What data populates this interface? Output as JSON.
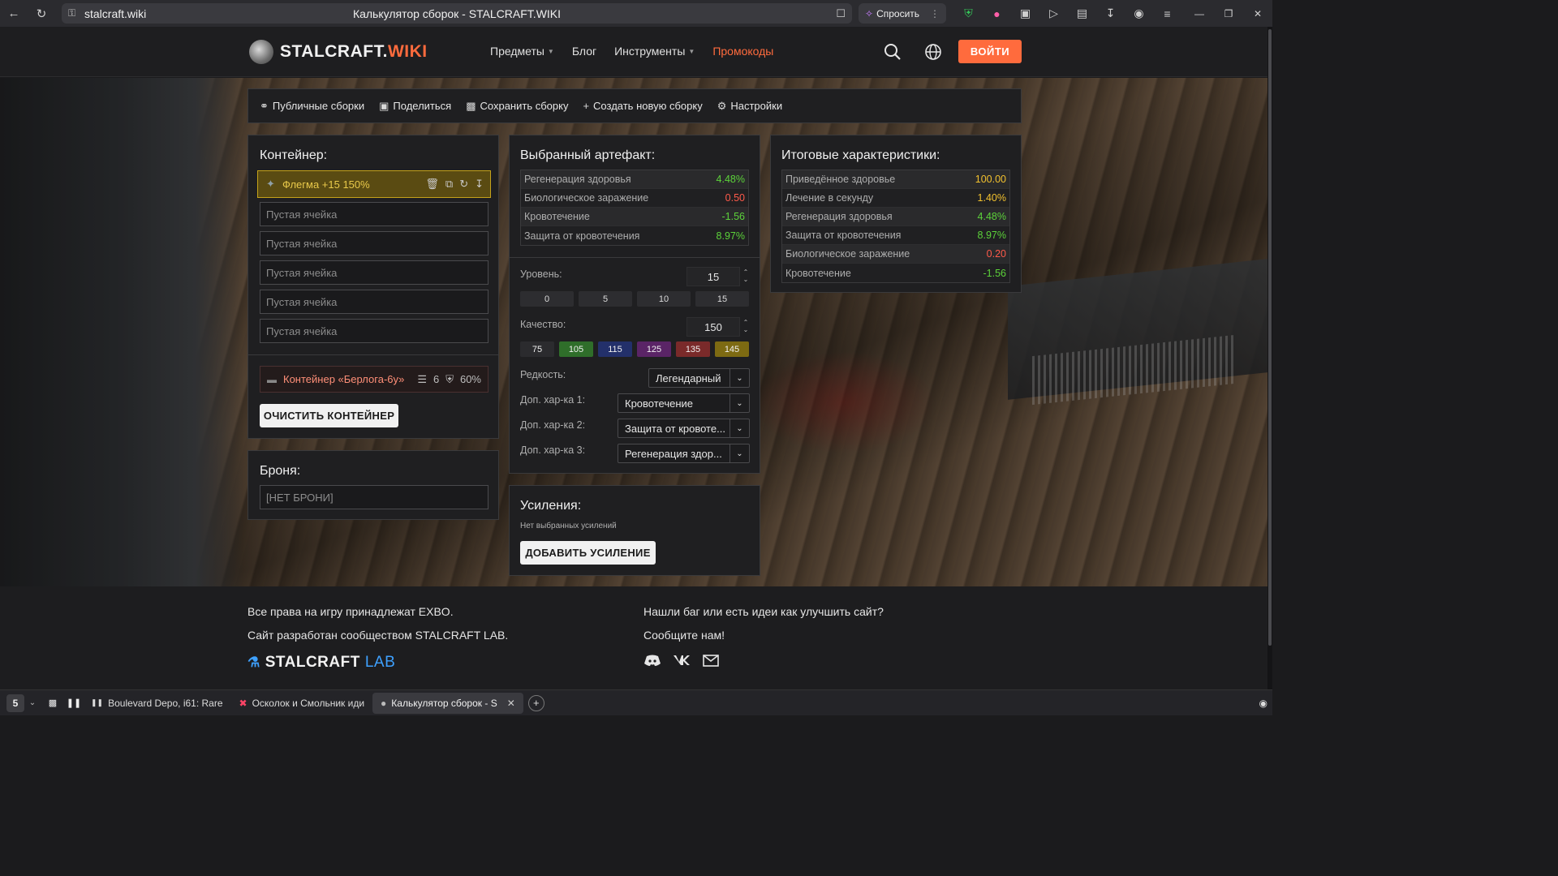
{
  "browser": {
    "url": "stalcraft.wiki",
    "tab_title": "Калькулятор сборок - STALCRAFT.WIKI",
    "ask_label": "Спросить"
  },
  "header": {
    "logo_main": "STALCRAFT.",
    "logo_accent": "WIKI",
    "nav": {
      "items": "Предметы",
      "blog": "Блог",
      "tools": "Инструменты",
      "promo": "Промокоды"
    },
    "login": "ВОЙТИ"
  },
  "toolbar": {
    "public_builds": "Публичные сборки",
    "share": "Поделиться",
    "save_build": "Сохранить сборку",
    "new_build": "Создать новую сборку",
    "settings": "Настройки"
  },
  "container": {
    "title": "Контейнер:",
    "artifact": "Флегма +15 150%",
    "slots": [
      "Пустая ячейка",
      "Пустая ячейка",
      "Пустая ячейка",
      "Пустая ячейка",
      "Пустая ячейка"
    ],
    "item_name": "Контейнер «Берлога-6у»",
    "item_capacity": "6",
    "item_protection": "60%",
    "clear_button": "ОЧИСТИТЬ КОНТЕЙНЕР"
  },
  "armor": {
    "title": "Броня:",
    "value": "[НЕТ БРОНИ]"
  },
  "selected": {
    "title": "Выбранный артефакт:",
    "stats": [
      {
        "name": "Регенерация здоровья",
        "value": "4.48%",
        "tone": "green"
      },
      {
        "name": "Биологическое заражение",
        "value": "0.50",
        "tone": "red"
      },
      {
        "name": "Кровотечение",
        "value": "-1.56",
        "tone": "green"
      },
      {
        "name": "Защита от кровотечения",
        "value": "8.97%",
        "tone": "green"
      }
    ],
    "level_label": "Уровень:",
    "level_value": "15",
    "level_presets": [
      "0",
      "5",
      "10",
      "15"
    ],
    "quality_label": "Качество:",
    "quality_value": "150",
    "quality_presets": [
      "75",
      "105",
      "115",
      "125",
      "135",
      "145"
    ],
    "rarity_label": "Редкость:",
    "rarity_value": "Легендарный",
    "extra1_label": "Доп. хар-ка 1:",
    "extra1_value": "Кровотечение",
    "extra2_label": "Доп. хар-ка 2:",
    "extra2_value": "Защита от кровоте...",
    "extra3_label": "Доп. хар-ка 3:",
    "extra3_value": "Регенерация здор..."
  },
  "boosts": {
    "title": "Усиления:",
    "empty": "Нет выбранных усилений",
    "add_button": "ДОБАВИТЬ УСИЛЕНИЕ"
  },
  "totals": {
    "title": "Итоговые характеристики:",
    "stats": [
      {
        "name": "Приведённое здоровье",
        "value": "100.00",
        "tone": "yellow"
      },
      {
        "name": "Лечение в секунду",
        "value": "1.40%",
        "tone": "yellow"
      },
      {
        "name": "Регенерация здоровья",
        "value": "4.48%",
        "tone": "green"
      },
      {
        "name": "Защита от кровотечения",
        "value": "8.97%",
        "tone": "green"
      },
      {
        "name": "Биологическое заражение",
        "value": "0.20",
        "tone": "red"
      },
      {
        "name": "Кровотечение",
        "value": "-1.56",
        "tone": "green"
      }
    ]
  },
  "footer": {
    "rights": "Все права на игру принадлежат EXBO.",
    "made_by": "Сайт разработан сообществом STALCRAFT LAB.",
    "lab_main": "STALCRAFT",
    "lab_accent": "LAB",
    "bug_text": "Нашли баг или есть идеи как улучшить сайт?",
    "contact_text": "Сообщите нам!"
  },
  "taskbar": {
    "workspace": "5",
    "tabs": [
      {
        "title": "Boulevard Depo, i61: Rare"
      },
      {
        "title": "Осколок и Смольник иди"
      },
      {
        "title": "Калькулятор сборок - S"
      }
    ]
  }
}
